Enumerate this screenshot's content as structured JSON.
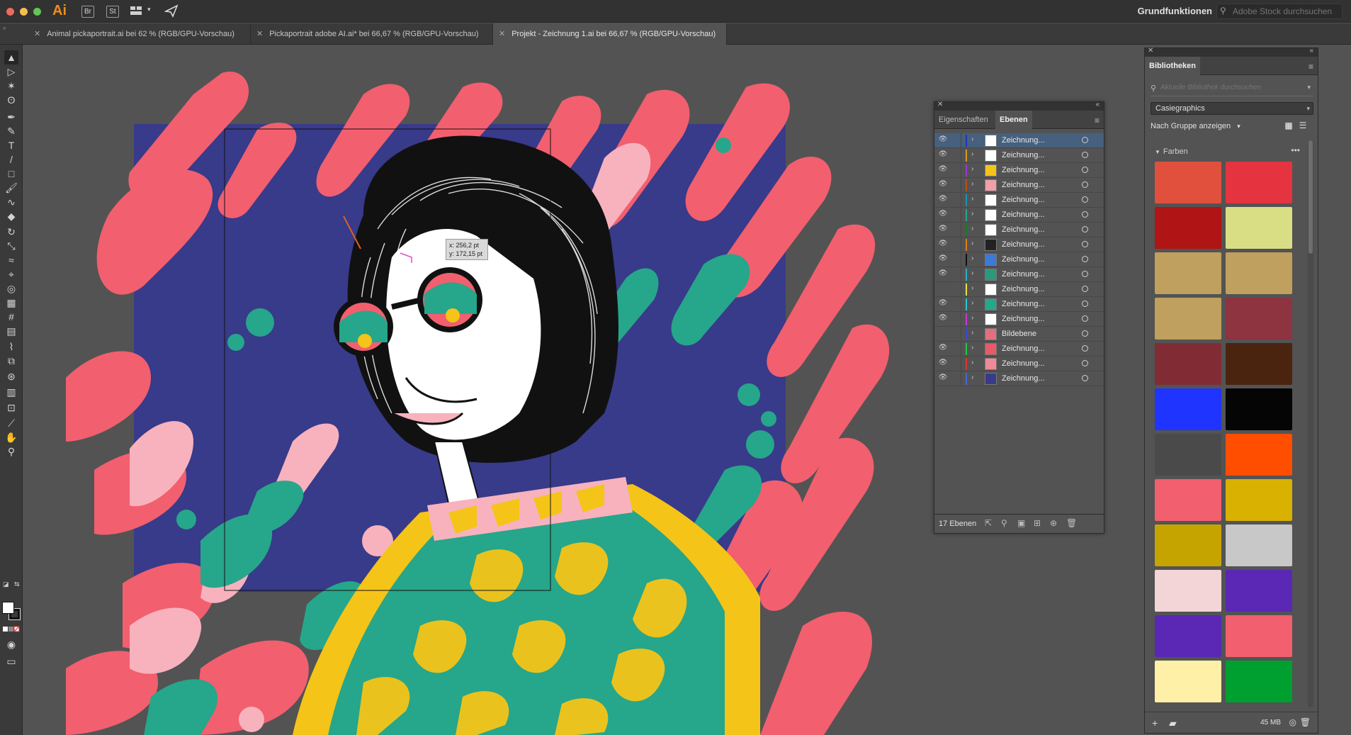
{
  "app": {
    "logo": "Ai",
    "bridge_label": "Br",
    "stock_label": "St",
    "workspace": "Grundfunktionen",
    "stock_search_placeholder": "Adobe Stock durchsuchen"
  },
  "tabs": [
    {
      "label": "Animal pickaportrait.ai bei 62 % (RGB/GPU-Vorschau)",
      "active": false
    },
    {
      "label": "Pickaportrait adobe AI.ai* bei 66,67 % (RGB/GPU-Vorschau)",
      "active": false
    },
    {
      "label": "Projekt - Zeichnung 1.ai bei 66,67 % (RGB/GPU-Vorschau)",
      "active": true
    }
  ],
  "toolbar": {
    "tools": [
      {
        "name": "selection-tool",
        "glyph": "▲"
      },
      {
        "name": "direct-selection-tool",
        "glyph": "▷"
      },
      {
        "name": "magic-wand-tool",
        "glyph": "✶"
      },
      {
        "name": "lasso-tool",
        "glyph": "ʘ"
      },
      {
        "name": "pen-tool",
        "glyph": "✒"
      },
      {
        "name": "curvature-tool",
        "glyph": "✎"
      },
      {
        "name": "type-tool",
        "glyph": "T"
      },
      {
        "name": "line-tool",
        "glyph": "/"
      },
      {
        "name": "rectangle-tool",
        "glyph": "□"
      },
      {
        "name": "paintbrush-tool",
        "glyph": "🖌"
      },
      {
        "name": "shaper-tool",
        "glyph": "∿"
      },
      {
        "name": "eraser-tool",
        "glyph": "◆"
      },
      {
        "name": "rotate-tool",
        "glyph": "↻"
      },
      {
        "name": "scale-tool",
        "glyph": "⤡"
      },
      {
        "name": "warp-tool",
        "glyph": "≈"
      },
      {
        "name": "free-transform-tool",
        "glyph": "⌖"
      },
      {
        "name": "shape-builder-tool",
        "glyph": "◎"
      },
      {
        "name": "perspective-grid-tool",
        "glyph": "▦"
      },
      {
        "name": "mesh-tool",
        "glyph": "#"
      },
      {
        "name": "gradient-tool",
        "glyph": "▤"
      },
      {
        "name": "eyedropper-tool",
        "glyph": "⌇"
      },
      {
        "name": "blend-tool",
        "glyph": "⧉"
      },
      {
        "name": "symbol-sprayer-tool",
        "glyph": "⊛"
      },
      {
        "name": "column-graph-tool",
        "glyph": "▥"
      },
      {
        "name": "artboard-tool",
        "glyph": "⊡"
      },
      {
        "name": "slice-tool",
        "glyph": "⟋"
      },
      {
        "name": "hand-tool",
        "glyph": "✋"
      },
      {
        "name": "zoom-tool",
        "glyph": "⚲"
      }
    ]
  },
  "canvas": {
    "cursor_x": "x: 256,2 pt",
    "cursor_y": "y: 172,15 pt"
  },
  "layers_panel": {
    "tab_properties": "Eigenschaften",
    "tab_layers": "Ebenen",
    "count_label": "17 Ebenen",
    "layers": [
      {
        "name": "Zeichnung...",
        "visible": true,
        "color": "#2236b4",
        "selected": true,
        "thumb": "#ffffff"
      },
      {
        "name": "Zeichnung...",
        "visible": true,
        "color": "#d89b18",
        "selected": false,
        "thumb": "#ffffff"
      },
      {
        "name": "Zeichnung...",
        "visible": true,
        "color": "#9a36d6",
        "selected": false,
        "thumb": "#f5c418"
      },
      {
        "name": "Zeichnung...",
        "visible": true,
        "color": "#b85018",
        "selected": false,
        "thumb": "#f0a0a8"
      },
      {
        "name": "Zeichnung...",
        "visible": true,
        "color": "#1896b8",
        "selected": false,
        "thumb": "#ffffff"
      },
      {
        "name": "Zeichnung...",
        "visible": true,
        "color": "#26a68a",
        "selected": false,
        "thumb": "#ffffff"
      },
      {
        "name": "Zeichnung...",
        "visible": true,
        "color": "#1a7a28",
        "selected": false,
        "thumb": "#ffffff"
      },
      {
        "name": "Zeichnung...",
        "visible": true,
        "color": "#e07a18",
        "selected": false,
        "thumb": "#222222"
      },
      {
        "name": "Zeichnung...",
        "visible": true,
        "color": "#111111",
        "selected": false,
        "thumb": "#3a7ad8"
      },
      {
        "name": "Zeichnung...",
        "visible": true,
        "color": "#24b4c8",
        "selected": false,
        "thumb": "#2a9a7a"
      },
      {
        "name": "Zeichnung...",
        "visible": false,
        "color": "#e8e048",
        "selected": false,
        "thumb": "#ffffff"
      },
      {
        "name": "Zeichnung...",
        "visible": true,
        "color": "#24c8d8",
        "selected": false,
        "thumb": "#26a68a"
      },
      {
        "name": "Zeichnung...",
        "visible": true,
        "color": "#c838d8",
        "selected": false,
        "thumb": "#ffffff"
      },
      {
        "name": "Bildebene",
        "visible": false,
        "color": "#3848d8",
        "selected": false,
        "thumb": "#e07080"
      },
      {
        "name": "Zeichnung...",
        "visible": true,
        "color": "#26c848",
        "selected": false,
        "thumb": "#e85a6a"
      },
      {
        "name": "Zeichnung...",
        "visible": true,
        "color": "#d83838",
        "selected": false,
        "thumb": "#f08a96"
      },
      {
        "name": "Zeichnung...",
        "visible": true,
        "color": "#4868d8",
        "selected": false,
        "thumb": "#383a8a"
      }
    ]
  },
  "libraries_panel": {
    "title": "Bibliotheken",
    "search_placeholder": "Aktuelle Bibliothek durchsuchen",
    "library_name": "Casiegraphics",
    "group_label": "Nach Gruppe anzeigen",
    "section_title": "Farben",
    "storage": "45 MB",
    "swatches": [
      "#e0503c",
      "#e5343f",
      "#b01414",
      "#d9de84",
      "#bfa05e",
      "#bfa05e",
      "#bfa05e",
      "#8e3340",
      "#812c35",
      "#4b2410",
      "#1f35ff",
      "#050505",
      "#4a4a4a",
      "#ff4e00",
      "#f25f6e",
      "#d9b100",
      "#c6a400",
      "#c8c8c8",
      "#f3d5d7",
      "#5a28b4",
      "#5a28b4",
      "#f25f6e",
      "#fff0a8",
      "#00a030"
    ]
  }
}
